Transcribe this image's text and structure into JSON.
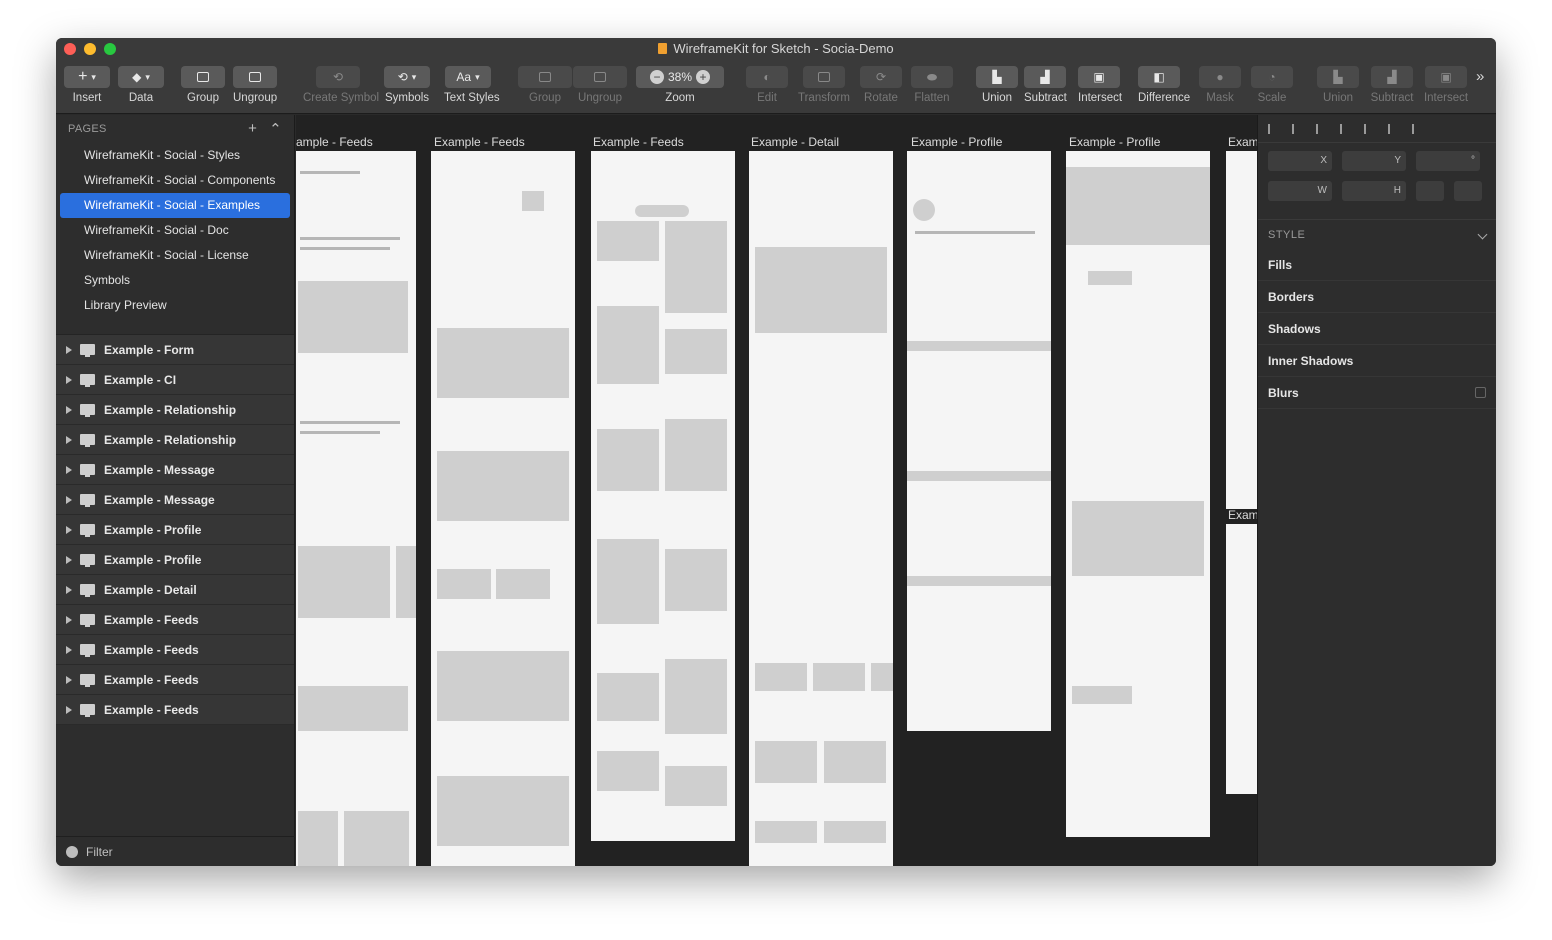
{
  "window": {
    "title": "WireframeKit for Sketch - Socia-Demo"
  },
  "toolbar": {
    "insert": "Insert",
    "data": "Data",
    "group": "Group",
    "ungroup": "Ungroup",
    "create_symbol": "Create Symbol",
    "symbols": "Symbols",
    "text_styles": "Text Styles",
    "text_styles_icon": "Aa",
    "group2": "Group",
    "ungroup2": "Ungroup",
    "zoom_label": "Zoom",
    "zoom_value": "38%",
    "zoom_minus": "−",
    "zoom_plus": "+",
    "edit": "Edit",
    "transform": "Transform",
    "rotate": "Rotate",
    "flatten": "Flatten",
    "union": "Union",
    "subtract": "Subtract",
    "intersect": "Intersect",
    "difference": "Difference",
    "mask": "Mask",
    "scale": "Scale",
    "union2": "Union",
    "subtract2": "Subtract",
    "intersect2": "Intersect",
    "more": "»"
  },
  "sidebar": {
    "pages_header": "PAGES",
    "pages": [
      "WireframeKit - Social - Styles",
      "WireframeKit - Social - Components",
      "WireframeKit - Social - Examples",
      "WireframeKit - Social - Doc",
      "WireframeKit - Social - License",
      "Symbols",
      "Library Preview"
    ],
    "selected_page": "WireframeKit - Social - Examples",
    "layers": [
      "Example - Form",
      "Example - CI",
      "Example - Relationship",
      "Example - Relationship",
      "Example - Message",
      "Example - Message",
      "Example - Profile",
      "Example - Profile",
      "Example - Detail",
      "Example - Feeds",
      "Example - Feeds",
      "Example - Feeds",
      "Example - Feeds"
    ],
    "filter": "Filter"
  },
  "canvas": {
    "artboards": [
      "ample - Feeds",
      "Example - Feeds",
      "Example - Feeds",
      "Example - Detail",
      "Example - Profile",
      "Example - Profile",
      "Exam",
      "Exam"
    ]
  },
  "inspector": {
    "x": "X",
    "y": "Y",
    "rot": "°",
    "w": "W",
    "h": "H",
    "style": "STYLE",
    "props": [
      "Fills",
      "Borders",
      "Shadows",
      "Inner Shadows",
      "Blurs"
    ]
  }
}
